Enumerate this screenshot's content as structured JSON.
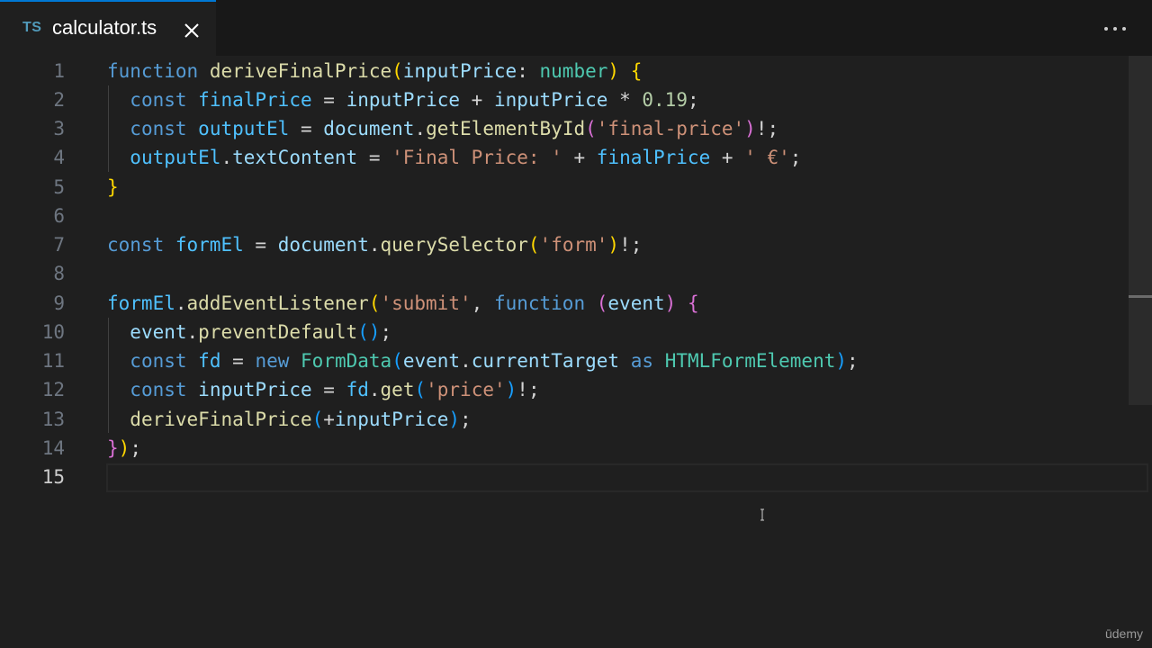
{
  "tab": {
    "lang_badge": "TS",
    "filename": "calculator.ts",
    "close_icon": "close-icon"
  },
  "toolbar": {
    "more_icon": "more-actions-icon"
  },
  "editor": {
    "active_line": "15",
    "line_numbers": [
      "1",
      "2",
      "3",
      "4",
      "5",
      "6",
      "7",
      "8",
      "9",
      "10",
      "11",
      "12",
      "13",
      "14",
      "15"
    ],
    "lines": [
      "function deriveFinalPrice(inputPrice: number) {",
      "  const finalPrice = inputPrice + inputPrice * 0.19;",
      "  const outputEl = document.getElementById('final-price')!;",
      "  outputEl.textContent = 'Final Price: ' + finalPrice + ' €';",
      "}",
      "",
      "const formEl = document.querySelector('form')!;",
      "",
      "formEl.addEventListener('submit', function (event) {",
      "  event.preventDefault();",
      "  const fd = new FormData(event.currentTarget as HTMLFormElement);",
      "  const inputPrice = fd.get('price')!;",
      "  deriveFinalPrice(+inputPrice);",
      "});",
      ""
    ]
  },
  "watermark": "ūdemy",
  "colors": {
    "background": "#1f1f1f",
    "tabbar": "#181818",
    "accent": "#0078d4",
    "keyword": "#569cd6",
    "function": "#dcdcaa",
    "variable": "#9cdcfe",
    "string": "#ce9178",
    "number": "#b5cea8",
    "type": "#4ec9b0"
  }
}
